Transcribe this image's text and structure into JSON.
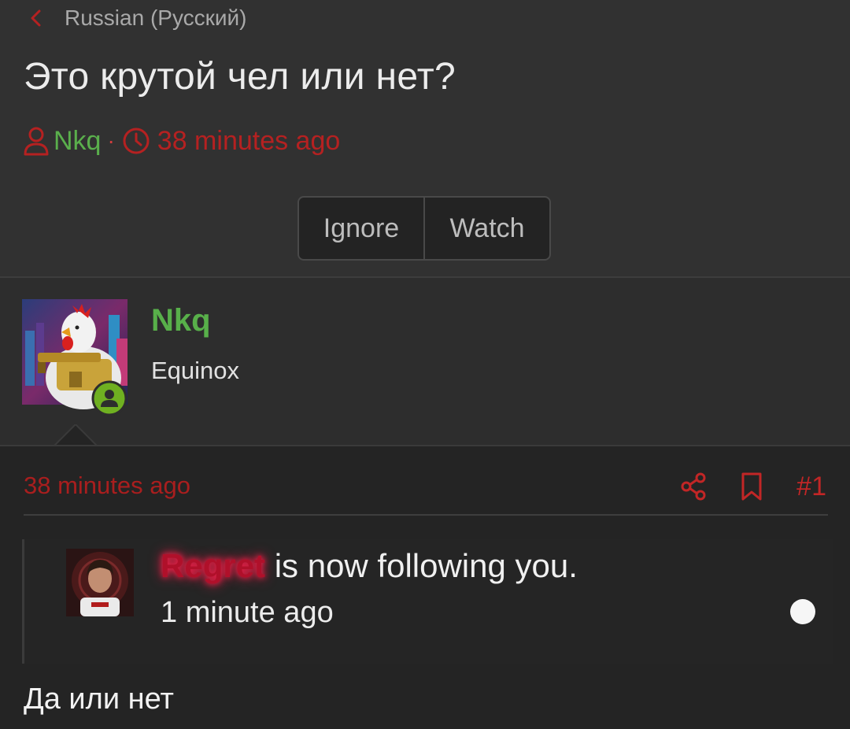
{
  "breadcrumb": {
    "label": "Russian (Русский)"
  },
  "thread": {
    "title": "Это крутой чел или нет?",
    "author": "Nkq",
    "separator": "·",
    "posted": "38 minutes ago"
  },
  "actions": {
    "ignore": "Ignore",
    "watch": "Watch"
  },
  "poster": {
    "name": "Nkq",
    "user_title": "Equinox"
  },
  "post": {
    "time": "38 minutes ago",
    "number": "#1",
    "body": "Да или нет"
  },
  "notification": {
    "username": "Regret",
    "text": " is now following you.",
    "time": "1 minute ago"
  },
  "colors": {
    "accent_red": "#b52121",
    "username_green": "#5aaf4c",
    "online_green": "#6fb021"
  },
  "icons": [
    "chevron-left-icon",
    "user-icon",
    "clock-icon",
    "share-icon",
    "bookmark-icon",
    "online-status-icon"
  ]
}
